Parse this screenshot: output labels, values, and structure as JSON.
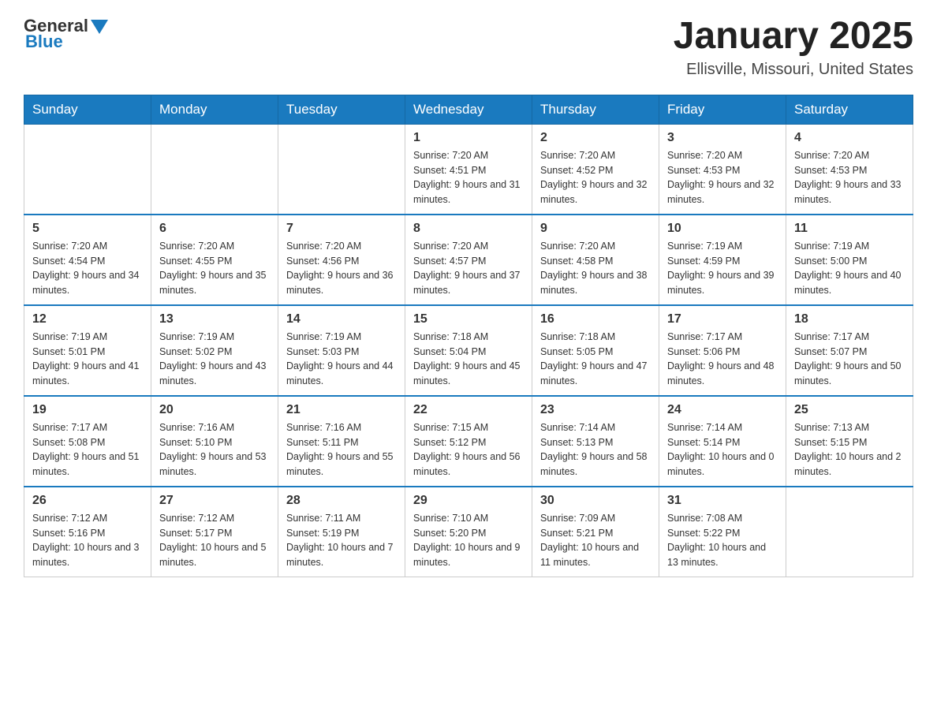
{
  "header": {
    "logo": {
      "general": "General",
      "blue": "Blue"
    },
    "title": "January 2025",
    "location": "Ellisville, Missouri, United States"
  },
  "calendar": {
    "days_of_week": [
      "Sunday",
      "Monday",
      "Tuesday",
      "Wednesday",
      "Thursday",
      "Friday",
      "Saturday"
    ],
    "weeks": [
      [
        {
          "day": "",
          "info": ""
        },
        {
          "day": "",
          "info": ""
        },
        {
          "day": "",
          "info": ""
        },
        {
          "day": "1",
          "info": "Sunrise: 7:20 AM\nSunset: 4:51 PM\nDaylight: 9 hours\nand 31 minutes."
        },
        {
          "day": "2",
          "info": "Sunrise: 7:20 AM\nSunset: 4:52 PM\nDaylight: 9 hours\nand 32 minutes."
        },
        {
          "day": "3",
          "info": "Sunrise: 7:20 AM\nSunset: 4:53 PM\nDaylight: 9 hours\nand 32 minutes."
        },
        {
          "day": "4",
          "info": "Sunrise: 7:20 AM\nSunset: 4:53 PM\nDaylight: 9 hours\nand 33 minutes."
        }
      ],
      [
        {
          "day": "5",
          "info": "Sunrise: 7:20 AM\nSunset: 4:54 PM\nDaylight: 9 hours\nand 34 minutes."
        },
        {
          "day": "6",
          "info": "Sunrise: 7:20 AM\nSunset: 4:55 PM\nDaylight: 9 hours\nand 35 minutes."
        },
        {
          "day": "7",
          "info": "Sunrise: 7:20 AM\nSunset: 4:56 PM\nDaylight: 9 hours\nand 36 minutes."
        },
        {
          "day": "8",
          "info": "Sunrise: 7:20 AM\nSunset: 4:57 PM\nDaylight: 9 hours\nand 37 minutes."
        },
        {
          "day": "9",
          "info": "Sunrise: 7:20 AM\nSunset: 4:58 PM\nDaylight: 9 hours\nand 38 minutes."
        },
        {
          "day": "10",
          "info": "Sunrise: 7:19 AM\nSunset: 4:59 PM\nDaylight: 9 hours\nand 39 minutes."
        },
        {
          "day": "11",
          "info": "Sunrise: 7:19 AM\nSunset: 5:00 PM\nDaylight: 9 hours\nand 40 minutes."
        }
      ],
      [
        {
          "day": "12",
          "info": "Sunrise: 7:19 AM\nSunset: 5:01 PM\nDaylight: 9 hours\nand 41 minutes."
        },
        {
          "day": "13",
          "info": "Sunrise: 7:19 AM\nSunset: 5:02 PM\nDaylight: 9 hours\nand 43 minutes."
        },
        {
          "day": "14",
          "info": "Sunrise: 7:19 AM\nSunset: 5:03 PM\nDaylight: 9 hours\nand 44 minutes."
        },
        {
          "day": "15",
          "info": "Sunrise: 7:18 AM\nSunset: 5:04 PM\nDaylight: 9 hours\nand 45 minutes."
        },
        {
          "day": "16",
          "info": "Sunrise: 7:18 AM\nSunset: 5:05 PM\nDaylight: 9 hours\nand 47 minutes."
        },
        {
          "day": "17",
          "info": "Sunrise: 7:17 AM\nSunset: 5:06 PM\nDaylight: 9 hours\nand 48 minutes."
        },
        {
          "day": "18",
          "info": "Sunrise: 7:17 AM\nSunset: 5:07 PM\nDaylight: 9 hours\nand 50 minutes."
        }
      ],
      [
        {
          "day": "19",
          "info": "Sunrise: 7:17 AM\nSunset: 5:08 PM\nDaylight: 9 hours\nand 51 minutes."
        },
        {
          "day": "20",
          "info": "Sunrise: 7:16 AM\nSunset: 5:10 PM\nDaylight: 9 hours\nand 53 minutes."
        },
        {
          "day": "21",
          "info": "Sunrise: 7:16 AM\nSunset: 5:11 PM\nDaylight: 9 hours\nand 55 minutes."
        },
        {
          "day": "22",
          "info": "Sunrise: 7:15 AM\nSunset: 5:12 PM\nDaylight: 9 hours\nand 56 minutes."
        },
        {
          "day": "23",
          "info": "Sunrise: 7:14 AM\nSunset: 5:13 PM\nDaylight: 9 hours\nand 58 minutes."
        },
        {
          "day": "24",
          "info": "Sunrise: 7:14 AM\nSunset: 5:14 PM\nDaylight: 10 hours\nand 0 minutes."
        },
        {
          "day": "25",
          "info": "Sunrise: 7:13 AM\nSunset: 5:15 PM\nDaylight: 10 hours\nand 2 minutes."
        }
      ],
      [
        {
          "day": "26",
          "info": "Sunrise: 7:12 AM\nSunset: 5:16 PM\nDaylight: 10 hours\nand 3 minutes."
        },
        {
          "day": "27",
          "info": "Sunrise: 7:12 AM\nSunset: 5:17 PM\nDaylight: 10 hours\nand 5 minutes."
        },
        {
          "day": "28",
          "info": "Sunrise: 7:11 AM\nSunset: 5:19 PM\nDaylight: 10 hours\nand 7 minutes."
        },
        {
          "day": "29",
          "info": "Sunrise: 7:10 AM\nSunset: 5:20 PM\nDaylight: 10 hours\nand 9 minutes."
        },
        {
          "day": "30",
          "info": "Sunrise: 7:09 AM\nSunset: 5:21 PM\nDaylight: 10 hours\nand 11 minutes."
        },
        {
          "day": "31",
          "info": "Sunrise: 7:08 AM\nSunset: 5:22 PM\nDaylight: 10 hours\nand 13 minutes."
        },
        {
          "day": "",
          "info": ""
        }
      ]
    ]
  }
}
